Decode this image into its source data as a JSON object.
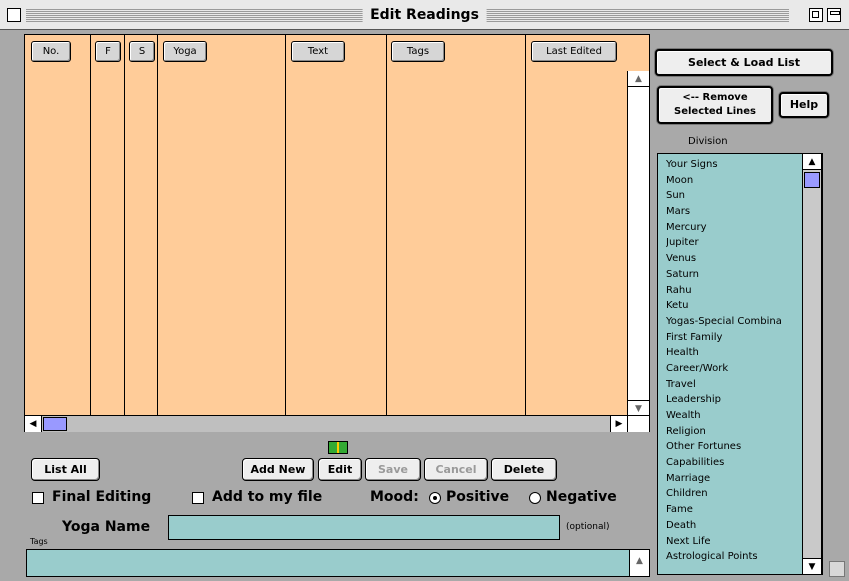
{
  "window": {
    "title": "Edit Readings"
  },
  "columns": [
    {
      "label": "No."
    },
    {
      "label": "F"
    },
    {
      "label": "S"
    },
    {
      "label": "Yoga"
    },
    {
      "label": "Text"
    },
    {
      "label": "Tags"
    },
    {
      "label": "Last Edited"
    }
  ],
  "buttons": {
    "select_load": "Select & Load List",
    "remove_selected_line1": "<-- Remove",
    "remove_selected_line2": "Selected Lines",
    "help": "Help",
    "list_all": "List All",
    "add_new": "Add New",
    "edit": "Edit",
    "save": "Save",
    "cancel": "Cancel",
    "delete": "Delete"
  },
  "options": {
    "final_editing": "Final Editing",
    "add_to_file": "Add to my file",
    "mood_label": "Mood:",
    "mood_positive": "Positive",
    "mood_negative": "Negative",
    "mood_selected": "Positive"
  },
  "form": {
    "yoga_name_label": "Yoga Name",
    "yoga_name_value": "",
    "optional_note": "(optional)",
    "tags_label": "Tags",
    "tags_value": ""
  },
  "division": {
    "label": "Division",
    "items": [
      "Your Signs",
      "Moon",
      "Sun",
      "Mars",
      "Mercury",
      "Jupiter",
      "Venus",
      "Saturn",
      "Rahu",
      "Ketu",
      "Yogas-Special Combina",
      "First Family",
      "Health",
      "Career/Work",
      "Travel",
      "Leadership",
      "Wealth",
      "Religion",
      "Other Fortunes",
      "Capabilities",
      "Marriage",
      "Children",
      "Fame",
      "Death",
      "Next Life",
      "Astrological Points"
    ]
  },
  "colors": {
    "grid_bg": "#ffcc99",
    "field_bg": "#99cccc",
    "scroll_thumb": "#9999ff"
  }
}
